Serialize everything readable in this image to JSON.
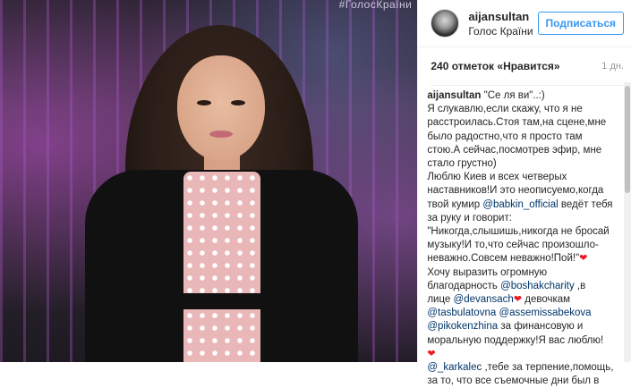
{
  "photo": {
    "watermark": "#ГолосКраїни"
  },
  "header": {
    "username": "aijansultan",
    "location": "Голос Країни",
    "follow_label": "Подписаться"
  },
  "meta": {
    "likes": "240 отметок «Нравится»",
    "time": "1 дн."
  },
  "caption": {
    "username": "aijansultan",
    "l1": "\"Се ля ви\"..:)",
    "l2": "Я слукавлю,если скажу, что я не",
    "l3": "расстроилась.Стоя там,на сцене,мне",
    "l4": "было радостно,что я просто там",
    "l5": "стою.А сейчас,посмотрев эфир, мне",
    "l6": "стало грустно)",
    "l7": "Люблю Киев и всех четверых",
    "l8": "наставников!И это неописуемо,когда",
    "l9a": "твой кумир ",
    "m1": "@babkin_official",
    "l9b": " ведёт тебя",
    "l10": "за руку и говорит:",
    "l11": "\"Никогда,слышишь,никогда не бросай",
    "l12": "музыку!И то,что сейчас произошло-",
    "l13": "неважно.Совсем неважно!Пой!\"",
    "l14": "Хочу выразить огромную",
    "l15a": "благодарность ",
    "m2": "@boshakcharity",
    "l15b": " ,в",
    "l16a": "лице ",
    "m3": "@devansach",
    "l16b": " девочкам",
    "m4": "@tasbulatovna",
    "m5": "@assemissabekova",
    "m6": "@pikokenzhina",
    "l18b": " за финансовую и",
    "l19": "моральную поддержку!Я вас люблю!",
    "m7": "@_karkalec",
    "l21b": " ,тебе за терпение,помощь,",
    "l22": "за то, что все съемочные дни был в",
    "heart": "❤"
  },
  "colors": {
    "link": "#003569",
    "follow": "#3897f0",
    "heart": "#ed1c24"
  }
}
